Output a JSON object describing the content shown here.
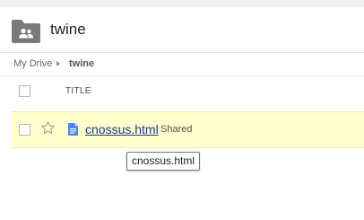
{
  "folder": {
    "title": "twine",
    "icon": "shared-folder-icon"
  },
  "breadcrumb": {
    "root": "My Drive",
    "current": "twine"
  },
  "list": {
    "columns": {
      "title": "TITLE"
    },
    "rows": [
      {
        "name": "cnossus.html",
        "status": "Shared",
        "icon": "document-icon",
        "starred": false
      }
    ]
  },
  "tooltip": {
    "text": "cnossus.html"
  },
  "colors": {
    "row_highlight": "#ffffcc",
    "doc_icon": "#4a86e8",
    "link": "#1a3a8c"
  }
}
